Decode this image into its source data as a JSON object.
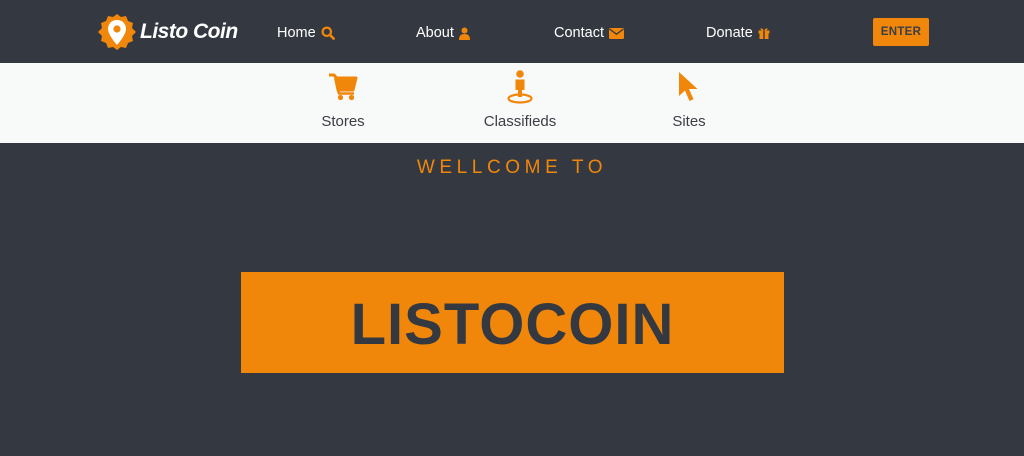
{
  "header": {
    "logo_text": "Listo Coin",
    "nav": [
      {
        "label": "Home",
        "icon": "search-icon"
      },
      {
        "label": "About",
        "icon": "user-icon"
      },
      {
        "label": "Contact",
        "icon": "envelope-icon"
      },
      {
        "label": "Donate",
        "icon": "gift-icon"
      }
    ],
    "enter_label": "ENTER"
  },
  "categories": [
    {
      "label": "Stores",
      "icon": "cart-icon"
    },
    {
      "label": "Classifieds",
      "icon": "person-pin-icon"
    },
    {
      "label": "Sites",
      "icon": "cursor-icon"
    }
  ],
  "hero": {
    "welcome": "WELLCOME TO",
    "title": "LISTOCOIN"
  },
  "colors": {
    "background": "#343941",
    "accent": "#f0860a",
    "subbar": "#f8f9f9",
    "text_light": "#ffffff",
    "text_dark": "#3a3f45"
  }
}
